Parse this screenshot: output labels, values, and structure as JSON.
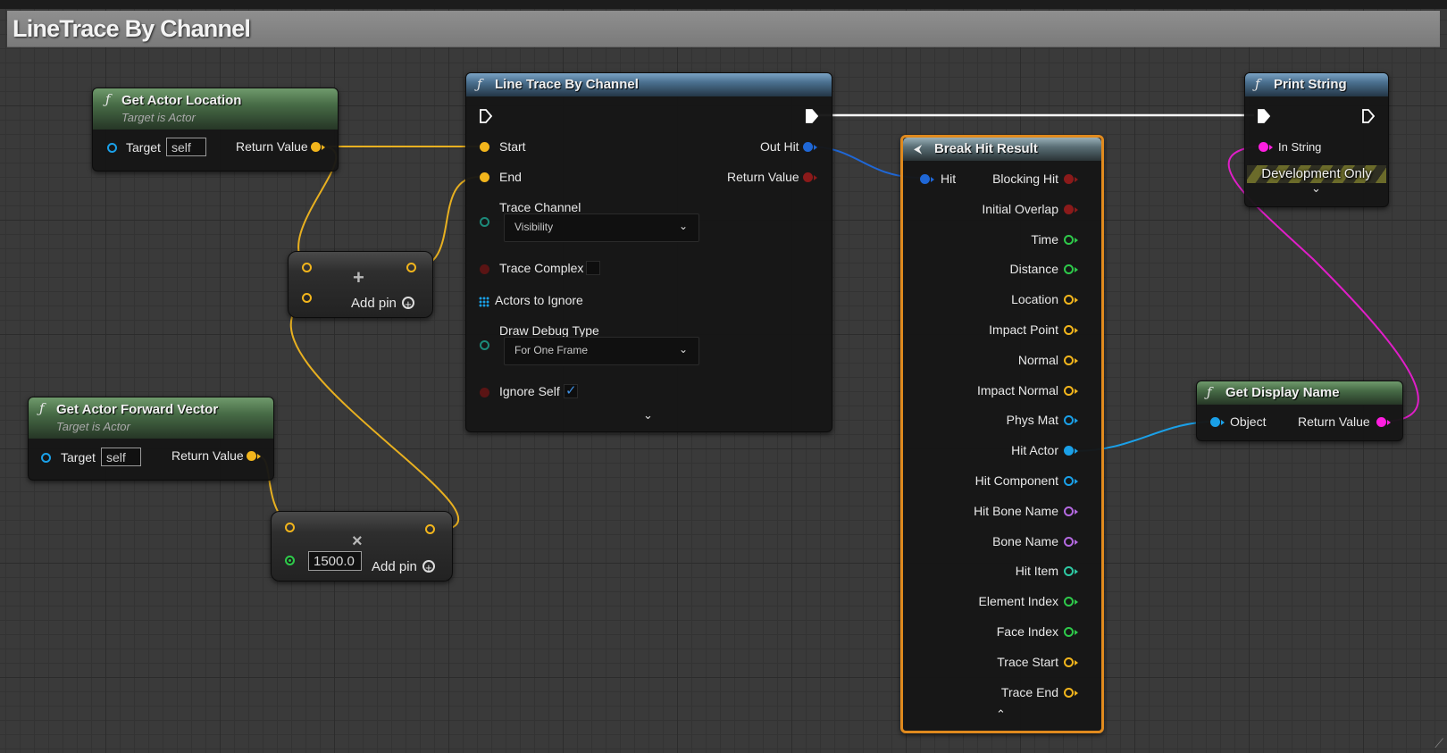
{
  "comment": {
    "title": "LineTrace By Channel"
  },
  "nodes": {
    "get_actor_location": {
      "title": "Get Actor Location",
      "subtitle": "Target is Actor",
      "target_label": "Target",
      "target_value": "self",
      "return_label": "Return Value"
    },
    "get_actor_forward_vector": {
      "title": "Get Actor Forward Vector",
      "subtitle": "Target is Actor",
      "target_label": "Target",
      "target_value": "self",
      "return_label": "Return Value"
    },
    "add_node": {
      "op_symbol": "+",
      "add_pin_label": "Add pin"
    },
    "multiply_node": {
      "op_symbol": "×",
      "value": "1500.0",
      "add_pin_label": "Add pin"
    },
    "line_trace": {
      "title": "Line Trace By Channel",
      "start_label": "Start",
      "end_label": "End",
      "out_hit_label": "Out Hit",
      "return_label": "Return Value",
      "trace_channel_label": "Trace Channel",
      "trace_channel_value": "Visibility",
      "trace_complex_label": "Trace Complex",
      "actors_to_ignore_label": "Actors to Ignore",
      "draw_debug_label": "Draw Debug Type",
      "draw_debug_value": "For One Frame",
      "ignore_self_label": "Ignore Self",
      "ignore_self_checked": true
    },
    "break_hit_result": {
      "title": "Break Hit Result",
      "hit_label": "Hit",
      "outputs": [
        {
          "label": "Blocking Hit",
          "color": "#8b1a1a",
          "style": "filled"
        },
        {
          "label": "Initial Overlap",
          "color": "#8b1a1a",
          "style": "filled"
        },
        {
          "label": "Time",
          "color": "#2ec94a",
          "style": "hollow"
        },
        {
          "label": "Distance",
          "color": "#2ec94a",
          "style": "hollow"
        },
        {
          "label": "Location",
          "color": "#f2b51c",
          "style": "hollow"
        },
        {
          "label": "Impact Point",
          "color": "#f2b51c",
          "style": "hollow"
        },
        {
          "label": "Normal",
          "color": "#f2b51c",
          "style": "hollow"
        },
        {
          "label": "Impact Normal",
          "color": "#f2b51c",
          "style": "hollow"
        },
        {
          "label": "Phys Mat",
          "color": "#1aa0e8",
          "style": "hollow"
        },
        {
          "label": "Hit Actor",
          "color": "#1aa0e8",
          "style": "filled"
        },
        {
          "label": "Hit Component",
          "color": "#1aa0e8",
          "style": "hollow"
        },
        {
          "label": "Hit Bone Name",
          "color": "#b469e0",
          "style": "hollow"
        },
        {
          "label": "Bone Name",
          "color": "#b469e0",
          "style": "hollow"
        },
        {
          "label": "Hit Item",
          "color": "#2ec9a3",
          "style": "hollow"
        },
        {
          "label": "Element Index",
          "color": "#2ec94a",
          "style": "hollow"
        },
        {
          "label": "Face Index",
          "color": "#2ec94a",
          "style": "hollow"
        },
        {
          "label": "Trace Start",
          "color": "#f2b51c",
          "style": "hollow"
        },
        {
          "label": "Trace End",
          "color": "#f2b51c",
          "style": "hollow"
        }
      ]
    },
    "print_string": {
      "title": "Print String",
      "in_string_label": "In String",
      "dev_only_label": "Development Only"
    },
    "get_display_name": {
      "title": "Get Display Name",
      "object_label": "Object",
      "return_label": "Return Value"
    }
  },
  "colors": {
    "vector": "#f2b51c",
    "object": "#1aa0e8",
    "struct": "#1f67d6",
    "bool": "#8b1a1a",
    "string": "#ff1ee0",
    "float": "#2ec94a",
    "exec": "#ffffff",
    "channel": "#1c8a7a",
    "selected_border": "#e08a1e"
  },
  "icons": {
    "function": "function-icon",
    "break": "break-struct-icon",
    "expand": "chevron-down-icon",
    "collapse": "chevron-up-icon"
  }
}
